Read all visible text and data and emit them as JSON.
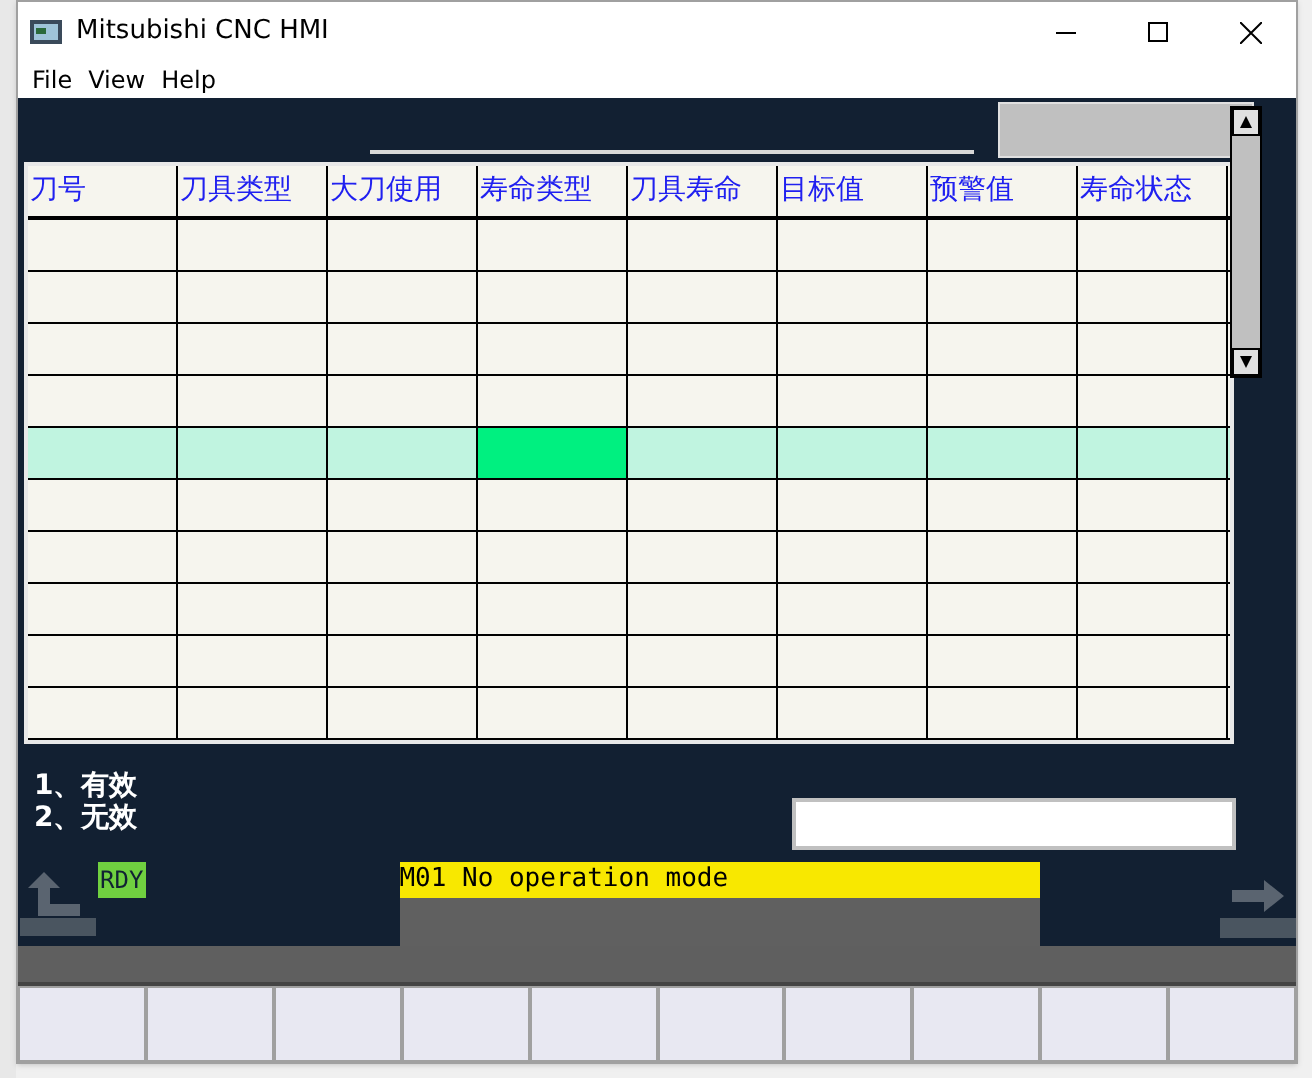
{
  "window": {
    "title": "Mitsubishi CNC HMI"
  },
  "menu": [
    "File",
    "View",
    "Help"
  ],
  "table": {
    "columns": [
      "刀号",
      "刀具类型",
      "大刀使用",
      "寿命类型",
      "刀具寿命",
      "目标值",
      "预警值",
      "寿命状态"
    ],
    "rows": [
      {
        "selected": false,
        "cells": [
          {
            "selected": false
          },
          {
            "selected": false
          },
          {
            "selected": false
          },
          {
            "selected": false
          },
          {
            "selected": false
          },
          {
            "selected": false
          },
          {
            "selected": false
          },
          {
            "selected": false
          }
        ]
      },
      {
        "selected": false,
        "cells": [
          {
            "selected": false
          },
          {
            "selected": false
          },
          {
            "selected": false
          },
          {
            "selected": false
          },
          {
            "selected": false
          },
          {
            "selected": false
          },
          {
            "selected": false
          },
          {
            "selected": false
          }
        ]
      },
      {
        "selected": false,
        "cells": [
          {
            "selected": false
          },
          {
            "selected": false
          },
          {
            "selected": false
          },
          {
            "selected": false
          },
          {
            "selected": false
          },
          {
            "selected": false
          },
          {
            "selected": false
          },
          {
            "selected": false
          }
        ]
      },
      {
        "selected": false,
        "cells": [
          {
            "selected": false
          },
          {
            "selected": false
          },
          {
            "selected": false
          },
          {
            "selected": false
          },
          {
            "selected": false
          },
          {
            "selected": false
          },
          {
            "selected": false
          },
          {
            "selected": false
          }
        ]
      },
      {
        "selected": true,
        "cells": [
          {
            "selected": false
          },
          {
            "selected": false
          },
          {
            "selected": false
          },
          {
            "selected": true
          },
          {
            "selected": false
          },
          {
            "selected": false
          },
          {
            "selected": false
          },
          {
            "selected": false
          }
        ]
      },
      {
        "selected": false,
        "cells": [
          {
            "selected": false
          },
          {
            "selected": false
          },
          {
            "selected": false
          },
          {
            "selected": false
          },
          {
            "selected": false
          },
          {
            "selected": false
          },
          {
            "selected": false
          },
          {
            "selected": false
          }
        ]
      },
      {
        "selected": false,
        "cells": [
          {
            "selected": false
          },
          {
            "selected": false
          },
          {
            "selected": false
          },
          {
            "selected": false
          },
          {
            "selected": false
          },
          {
            "selected": false
          },
          {
            "selected": false
          },
          {
            "selected": false
          }
        ]
      },
      {
        "selected": false,
        "cells": [
          {
            "selected": false
          },
          {
            "selected": false
          },
          {
            "selected": false
          },
          {
            "selected": false
          },
          {
            "selected": false
          },
          {
            "selected": false
          },
          {
            "selected": false
          },
          {
            "selected": false
          }
        ]
      },
      {
        "selected": false,
        "cells": [
          {
            "selected": false
          },
          {
            "selected": false
          },
          {
            "selected": false
          },
          {
            "selected": false
          },
          {
            "selected": false
          },
          {
            "selected": false
          },
          {
            "selected": false
          },
          {
            "selected": false
          }
        ]
      },
      {
        "selected": false,
        "cells": [
          {
            "selected": false
          },
          {
            "selected": false
          },
          {
            "selected": false
          },
          {
            "selected": false
          },
          {
            "selected": false
          },
          {
            "selected": false
          },
          {
            "selected": false
          },
          {
            "selected": false
          }
        ]
      }
    ]
  },
  "legend": [
    "1、有效",
    "2、无效"
  ],
  "status": {
    "ready": "RDY",
    "message": "M01 No operation mode"
  }
}
